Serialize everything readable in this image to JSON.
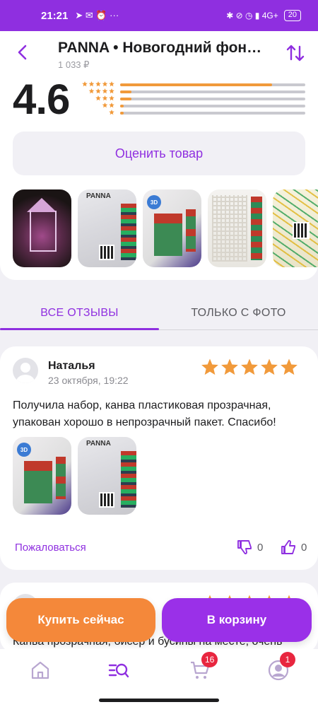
{
  "status_bar": {
    "time": "21:21",
    "left_icons": "➤ ✉ ⏰ ···",
    "right_icons": "✱ ⊘ ◷ ▮ 4G+",
    "battery": "20"
  },
  "header": {
    "title": "PANNA • Новогодний фон…",
    "price": "1 033 ₽"
  },
  "rating": {
    "value": "4.6",
    "distribution": [
      0.82,
      0.06,
      0.06,
      0.02,
      0.02
    ]
  },
  "rate_button": "Оценить товар",
  "photos": [
    "lantern",
    "pack",
    "box",
    "scheme",
    "threads"
  ],
  "tabs": {
    "all": "ВСЕ ОТЗЫВЫ",
    "photo": "ТОЛЬКО С ФОТО"
  },
  "review1": {
    "name": "Наталья",
    "date": "23 октября, 19:22",
    "stars": 5,
    "text": "Получила набор, канва пластиковая прозрачная, упакован хорошо в непрозрачный пакет. Спасибо!",
    "complain": "Пожаловаться",
    "dislikes": "0",
    "likes": "0"
  },
  "review2": {
    "text": "Канва прозрачная, бисер и бусины на месте, очень"
  },
  "buttons": {
    "buy": "Купить сейчас",
    "cart": "В корзину"
  },
  "nav": {
    "cart_badge": "16",
    "profile_badge": "1"
  },
  "colors": {
    "accent": "#8f2fe0",
    "orange": "#f4883a",
    "star": "#f19a3b",
    "badge": "#e8263f"
  }
}
